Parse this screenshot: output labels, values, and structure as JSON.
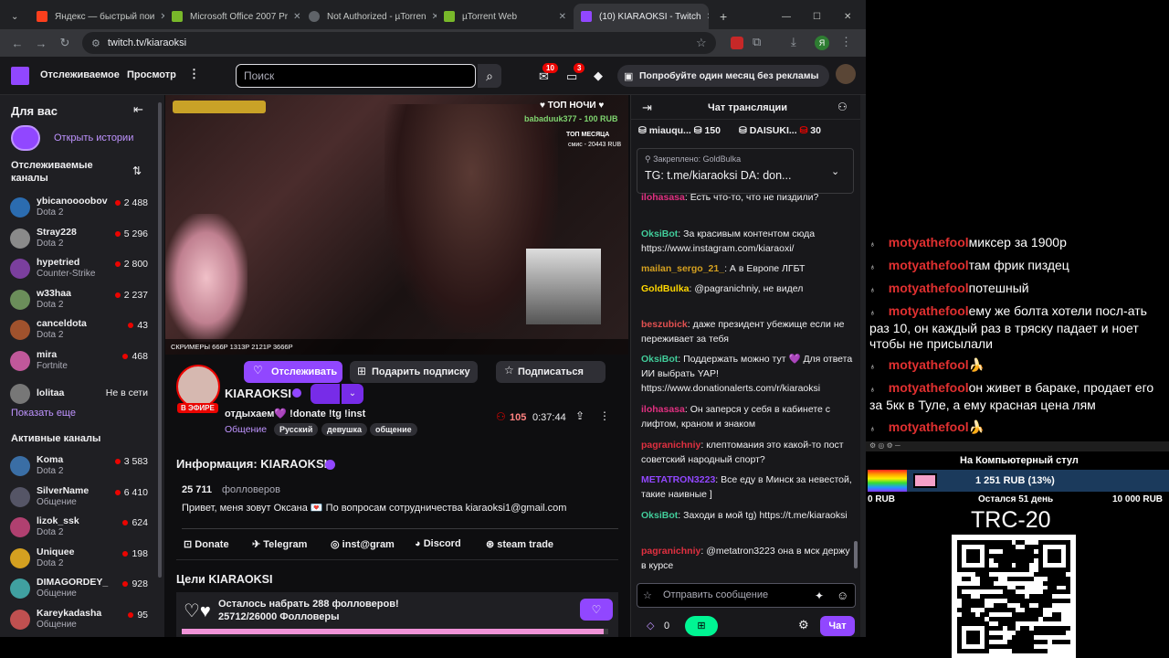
{
  "tabs": [
    {
      "label": "Яндекс — быстрый пои",
      "color": "#fc3f1d"
    },
    {
      "label": "Microsoft Office 2007 Pr",
      "color": "#78b82a"
    },
    {
      "label": "Not Authorized - µTorren",
      "color": "#9aa0a6"
    },
    {
      "label": "µTorrent Web",
      "color": "#78b82a"
    },
    {
      "label": "(10) KIARAOKSI - Twitch",
      "color": "#9147ff"
    }
  ],
  "address": "twitch.tv/kiaraoksi",
  "header": {
    "following": "Отслеживаемое",
    "browse": "Просмотр",
    "search_placeholder": "Поиск",
    "badge_inbox": "10",
    "badge_whispers": "3",
    "prime": "Попробуйте один месяц без рекламы"
  },
  "sidebar": {
    "for_you": "Для вас",
    "stories": "Открыть истории",
    "followed": "Отслеживаемые каналы",
    "followed_items": [
      {
        "name": "ybicanoooobov",
        "game": "Dota 2",
        "viewers": "2 488",
        "color": "#2b6cb0"
      },
      {
        "name": "Stray228",
        "game": "Dota 2",
        "viewers": "5 296",
        "color": "#8a8a8a"
      },
      {
        "name": "hypetried",
        "game": "Counter-Strike",
        "viewers": "2 800",
        "color": "#7b3f9e"
      },
      {
        "name": "w33haa",
        "game": "Dota 2",
        "viewers": "2 237",
        "color": "#6b8e5a"
      },
      {
        "name": "canceldota",
        "game": "Dota 2",
        "viewers": "43",
        "color": "#a0522d"
      },
      {
        "name": "mira",
        "game": "Fortnite",
        "viewers": "468",
        "color": "#c0589a"
      }
    ],
    "offline_name": "lolitaa",
    "offline_text": "Не в сети",
    "show_more": "Показать еще",
    "active": "Активные каналы",
    "active_items": [
      {
        "name": "Koma",
        "game": "Dota 2",
        "viewers": "3 583",
        "color": "#3a6ea5"
      },
      {
        "name": "SilverName",
        "game": "Общение",
        "viewers": "6 410",
        "color": "#556"
      },
      {
        "name": "lizok_ssk",
        "game": "Dota 2",
        "viewers": "624",
        "color": "#b04070"
      },
      {
        "name": "Uniquee",
        "game": "Dota 2",
        "viewers": "198",
        "color": "#d4a020"
      },
      {
        "name": "DIMAGORDEY_",
        "game": "Общение",
        "viewers": "928",
        "color": "#40a0a0"
      },
      {
        "name": "Kareykadasha",
        "game": "Общение",
        "viewers": "95",
        "color": "#c05050"
      }
    ]
  },
  "video": {
    "top_night": "ТОП НОЧИ",
    "donor": "babaduuk377 - 100 RUB",
    "top_month": "ТОП МЕСЯЦА",
    "month_donor": "смис - 20443 RUB",
    "bar": "СКРИМЕРЫ 666P 1313P 2121P 3666P"
  },
  "stream": {
    "channel": "KIARAOKSI",
    "live": "В ЭФИРЕ",
    "title": "отдыхаем💜 !donate !tg !inst",
    "category": "Общение",
    "tags": [
      "Русский",
      "девушка",
      "общение"
    ],
    "viewers": "105",
    "uptime": "0:37:44",
    "follow": "Отслеживать",
    "gift": "Подарить подписку",
    "subscribe": "Подписаться"
  },
  "about": {
    "heading": "Информация: KIARAOKSI",
    "followers_num": "25 711",
    "followers_label": "фолловеров",
    "bio": "Привет, меня зовут Оксана 💌 По вопросам сотрудничества kiaraoksi1@gmail.com",
    "links": [
      "Donate",
      "Telegram",
      "inst@gram",
      "Discord",
      "steam trade"
    ],
    "goals_heading": "Цели KIARAOKSI",
    "goal_text": "Осталось набрать 288 фолловеров!",
    "goal_progress": "25712/26000 Фолловеры",
    "goal_fraction": 0.989
  },
  "chat": {
    "title": "Чат трансляции",
    "leaders": [
      {
        "name": "miauqu...",
        "val": "150"
      },
      {
        "name": "DAISUKI...",
        "val": "30"
      }
    ],
    "pinned_label": "Закреплено:",
    "pinned_by": "GoldBulka",
    "pinned_text": "TG: t.me/kiaraoksi DA: don...",
    "messages": [
      {
        "user": "ilohasasa",
        "color": "#e03080",
        "text": "Есть что-то, что не пиздили?"
      },
      {
        "user": "OksiBot",
        "color": "#41cc9a",
        "text": "За красивым контентом сюда https://www.instagram.com/kiaraoxi/"
      },
      {
        "user": "mailan_sergo_21_",
        "color": "#d4a020",
        "text": "А в Европе ЛГБТ"
      },
      {
        "user": "GoldBulka",
        "color": "#ffd700",
        "text": "@pagranichniy, не видел"
      },
      {
        "user": "beszubick",
        "color": "#e05050",
        "text": "даже президент убежище если не переживает за тебя"
      },
      {
        "user": "OksiBot",
        "color": "#41cc9a",
        "text": "Поддержать можно тут 💜 Для ответа ИИ выбрать YAP! https://www.donationalerts.com/r/kiaraoksi"
      },
      {
        "user": "ilohasasa",
        "color": "#e03080",
        "text": "Он заперся у себя в кабинете с лифтом, краном и знаком"
      },
      {
        "user": "pagranichniy",
        "color": "#e03040",
        "text": "клептомания это какой-то пост советский народный спорт?"
      },
      {
        "user": "METATRON3223",
        "color": "#9147ff",
        "text": "Все еду в Минск за невестой, такие наивные ]"
      },
      {
        "user": "OksiBot",
        "color": "#41cc9a",
        "text": "Заходи в мой tg) https://t.me/kiaraoksi"
      },
      {
        "user": "pagranichniy",
        "color": "#e03040",
        "text": "@metatron3223 она в мск держу в курсе"
      }
    ],
    "input_placeholder": "Отправить сообщение",
    "points": "0",
    "send": "Чат"
  },
  "overlay": {
    "messages": [
      {
        "user": "motyathefool",
        "text": "миксер за 1900р"
      },
      {
        "user": "motyathefool",
        "text": "там фрик пиздец"
      },
      {
        "user": "motyathefool",
        "text": "потешный"
      },
      {
        "user": "motyathefool",
        "text": "ему же болта хотели посл-ать раз 10, он каждый раз в тряску падает и ноет чтобы не присылали"
      },
      {
        "user": "motyathefool",
        "text": "🍌"
      },
      {
        "user": "motyathefool",
        "text": "он живет в бараке, продает его за 5кк в Туле, а ему красная цена лям"
      },
      {
        "user": "motyathefool",
        "text": "🍌"
      }
    ],
    "goal_title": "На Компьютерный стул",
    "goal_amount": "1 251 RUB (13%)",
    "goal_fraction": 0.13,
    "goal_min": "0 RUB",
    "goal_days": "Остался 51 день",
    "goal_max": "10 000 RUB",
    "trc": "TRC-20"
  }
}
